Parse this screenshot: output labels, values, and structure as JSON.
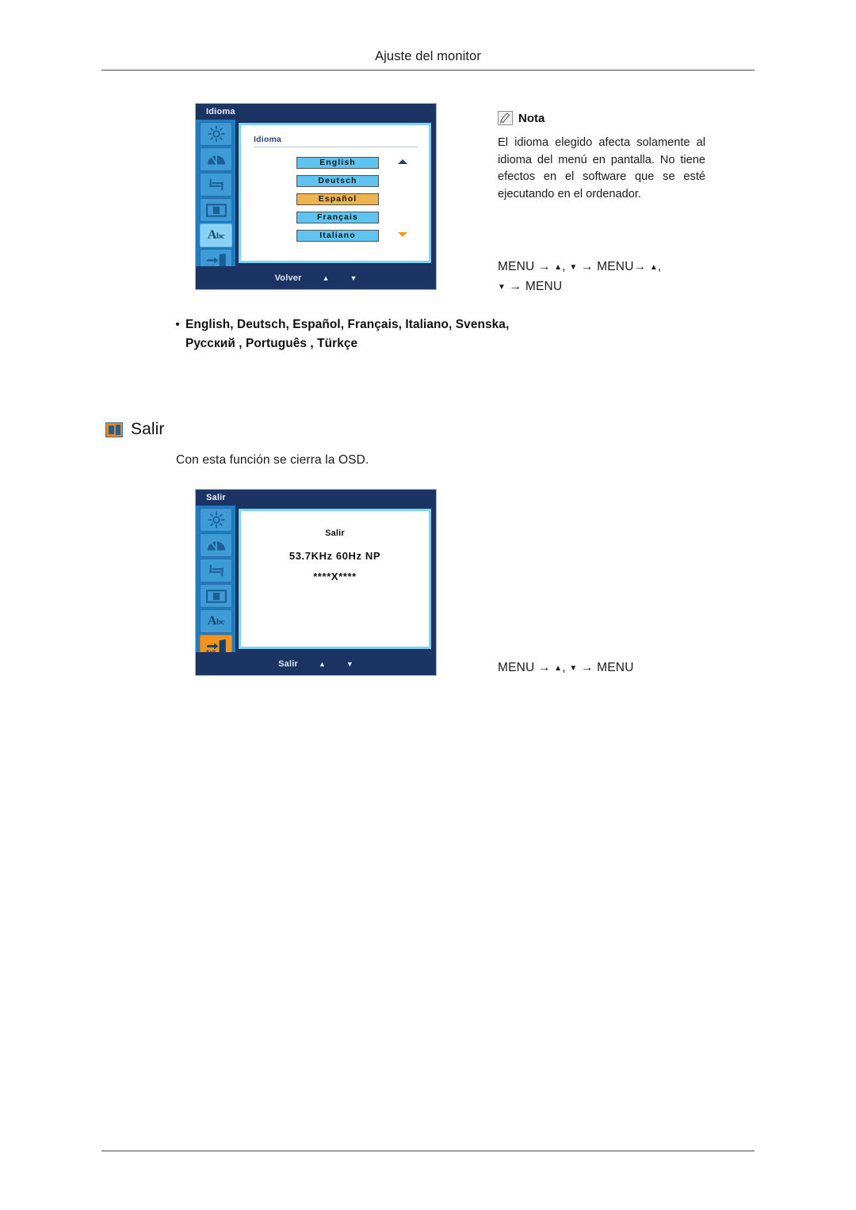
{
  "page": {
    "header_title": "Ajuste del monitor"
  },
  "osd_language": {
    "title": "Idioma",
    "panel_label": "Idioma",
    "options": [
      {
        "label": "English",
        "selected": false
      },
      {
        "label": "Deutsch",
        "selected": false
      },
      {
        "label": "Español",
        "selected": true
      },
      {
        "label": "Français",
        "selected": false
      },
      {
        "label": "Italiano",
        "selected": false
      }
    ],
    "scroll_up_icon": "triangle-up-icon",
    "scroll_down_icon": "triangle-down-icon",
    "footer_label": "Volver",
    "footer_up": "▲",
    "footer_down": "▼",
    "sidebar_icons": [
      {
        "name": "brightness-icon",
        "state": "normal"
      },
      {
        "name": "contrast-gauge-icon",
        "state": "normal"
      },
      {
        "name": "image-reset-icon",
        "state": "normal"
      },
      {
        "name": "screen-size-icon",
        "state": "normal"
      },
      {
        "name": "language-abc-icon",
        "state": "selected-light"
      },
      {
        "name": "exit-door-icon",
        "state": "normal"
      }
    ]
  },
  "note": {
    "icon": "note-pencil-icon",
    "title": "Nota",
    "body": "El idioma elegido afecta solamente al idioma del menú en pantalla. No tiene efectos en el software que se esté ejecutando en el ordenador.",
    "menu_path_line1_a": "MENU",
    "menu_path_line1_arrow1": "→",
    "menu_path_line1_up": "▲",
    "menu_path_line1_comma": ",",
    "menu_path_line1_down": "▼",
    "menu_path_line1_arrow2": "→",
    "menu_path_line1_b": "MENU",
    "menu_path_line1_arrow3": "→",
    "menu_path_line1_up2": "▲",
    "menu_path_line1_comma2": ",",
    "menu_path_line2_down": "▼",
    "menu_path_line2_arrow": "→",
    "menu_path_line2_menu": "MENU"
  },
  "language_bullet": {
    "line1": "English, Deutsch, Español, Français,  Italiano, Svenska,",
    "line2": "Русский , Português , Türkçe"
  },
  "salir_section": {
    "icon": "exit-door-icon",
    "title": "Salir",
    "description": "Con esta función se cierra la OSD."
  },
  "osd_exit": {
    "title": "Salir",
    "panel_title": "Salir",
    "frequency": "53.7KHz 60Hz NP",
    "stars": "****X****",
    "footer_label": "Salir",
    "footer_up": "▲",
    "footer_down": "▼",
    "sidebar_icons": [
      {
        "name": "brightness-icon",
        "state": "normal"
      },
      {
        "name": "contrast-gauge-icon",
        "state": "normal"
      },
      {
        "name": "image-reset-icon",
        "state": "normal"
      },
      {
        "name": "screen-size-icon",
        "state": "normal"
      },
      {
        "name": "language-abc-icon",
        "state": "normal"
      },
      {
        "name": "exit-door-icon",
        "state": "selected-orange"
      }
    ]
  },
  "menu_path_exit": {
    "a": "MENU",
    "arrow1": "→",
    "up": "▲",
    "comma": ",",
    "down": "▼",
    "arrow2": "→",
    "b": "MENU"
  },
  "colors": {
    "osd_dark_blue": "#1c3464",
    "osd_sidebar_blue": "#1f7cc0",
    "osd_icon_blue": "#3e9bd6",
    "osd_selected_light": "#8ad2f5",
    "osd_selected_orange": "#f2941e",
    "option_blue": "#5ec3ee",
    "option_selected": "#edb44e",
    "screen_border": "#7fd4f2"
  }
}
